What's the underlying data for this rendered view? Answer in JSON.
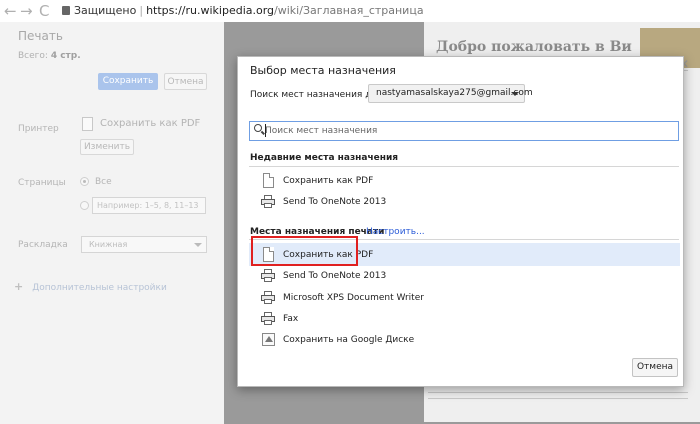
{
  "browser": {
    "secure_label": "Защищено",
    "url_host": "https://ru.wikipedia.org",
    "url_path": "/wiki/Заглавная_страница"
  },
  "print_panel": {
    "title": "Печать",
    "total_label": "Всего:",
    "total_value": "4 стр.",
    "save_button": "Сохранить",
    "cancel_button": "Отмена",
    "printer_label": "Принтер",
    "printer_value": "Сохранить как PDF",
    "change_button": "Изменить",
    "pages_label": "Страницы",
    "pages_all": "Все",
    "pages_placeholder": "Например: 1–5, 8, 11–13",
    "layout_label": "Раскладка",
    "layout_value": "Книжная",
    "more_settings": "Дополнительные настройки"
  },
  "preview": {
    "heading": "Добро пожаловать в Ви",
    "close_glyph": "✕"
  },
  "dialog": {
    "title": "Выбор места назначения",
    "search_dest_label": "Поиск мест назначения для",
    "account": "nastyamasalskaya275@gmail.com",
    "search_placeholder": "Поиск мест назначения",
    "recent_title": "Недавние места назначения",
    "recent": [
      {
        "label": "Сохранить как PDF",
        "icon": "pdf-document-icon"
      },
      {
        "label": "Send To OneNote 2013",
        "icon": "printer-icon"
      }
    ],
    "print_dest_title": "Места назначения печати",
    "configure_link": "Настроить...",
    "destinations": [
      {
        "label": "Сохранить как PDF",
        "icon": "pdf-document-icon",
        "selected": true
      },
      {
        "label": "Send To OneNote 2013",
        "icon": "printer-icon"
      },
      {
        "label": "Microsoft XPS Document Writer",
        "icon": "printer-icon"
      },
      {
        "label": "Fax",
        "icon": "printer-icon"
      },
      {
        "label": "Сохранить на Google Диске",
        "icon": "google-drive-icon"
      }
    ],
    "cancel_button": "Отмена"
  },
  "colors": {
    "highlight": "#e1ebfa",
    "annotation_red": "#e02020",
    "link": "#2a5bd7",
    "focus_border": "#6f9ee3"
  }
}
